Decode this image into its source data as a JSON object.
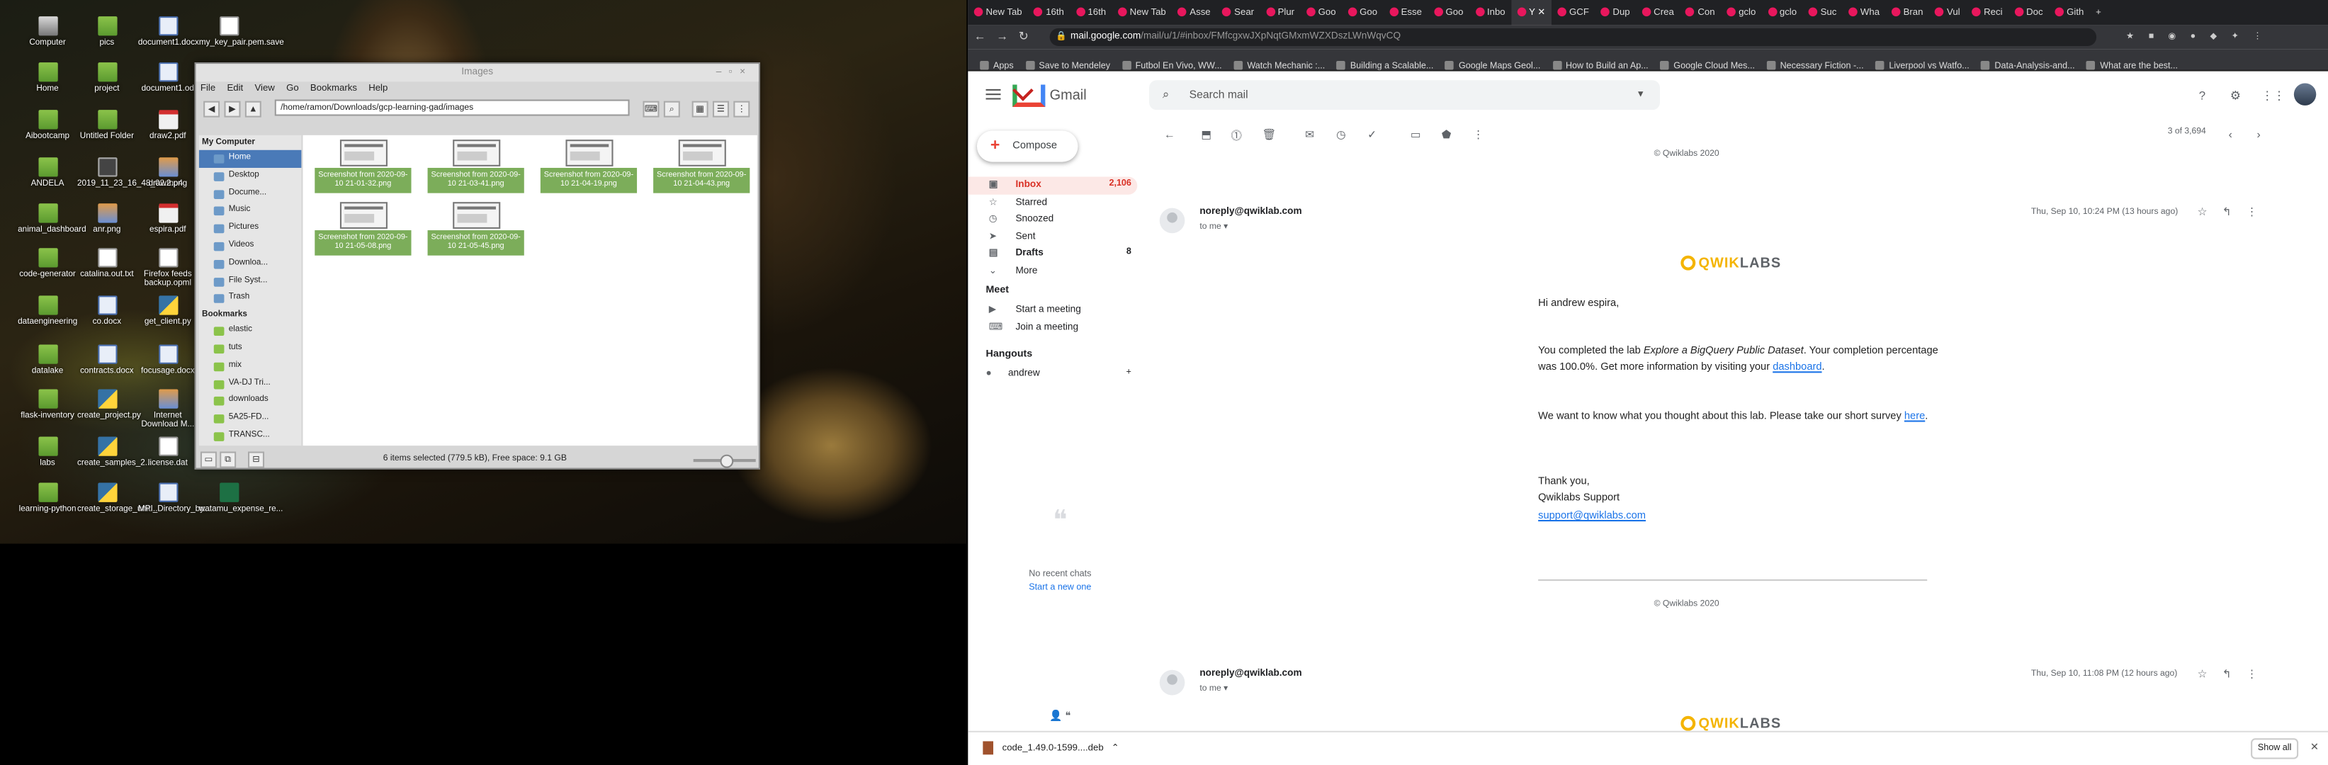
{
  "desktop": {
    "icons": [
      {
        "label": "Computer",
        "glyph": "g-comp"
      },
      {
        "label": "pics",
        "glyph": "g-folder"
      },
      {
        "label": "document1.docx",
        "glyph": "g-doc"
      },
      {
        "label": "my_key_pair.pem.save",
        "glyph": "g-txt"
      },
      {
        "label": "Home",
        "glyph": "g-folder"
      },
      {
        "label": "project",
        "glyph": "g-folder"
      },
      {
        "label": "document1.od",
        "glyph": "g-doc"
      },
      {
        "label": "Aibootcamp",
        "glyph": "g-folder"
      },
      {
        "label": "Untitled Folder",
        "glyph": "g-folder"
      },
      {
        "label": "draw2.pdf",
        "glyph": "g-pdf"
      },
      {
        "label": "ANDELA",
        "glyph": "g-folder"
      },
      {
        "label": "2019_11_23_16_48_02.mp4",
        "glyph": "g-mp4"
      },
      {
        "label": "draw2.png",
        "glyph": "g-img"
      },
      {
        "label": "animal_dashboard",
        "glyph": "g-folder"
      },
      {
        "label": "anr.png",
        "glyph": "g-img"
      },
      {
        "label": "espira.pdf",
        "glyph": "g-pdf"
      },
      {
        "label": "code-generator",
        "glyph": "g-folder"
      },
      {
        "label": "catalina.out.txt",
        "glyph": "g-txt"
      },
      {
        "label": "Firefox feeds backup.opml",
        "glyph": "g-txt"
      },
      {
        "label": "dataengineering",
        "glyph": "g-folder"
      },
      {
        "label": "co.docx",
        "glyph": "g-doc"
      },
      {
        "label": "get_client.py",
        "glyph": "g-py"
      },
      {
        "label": "datalake",
        "glyph": "g-folder"
      },
      {
        "label": "contracts.docx",
        "glyph": "g-doc"
      },
      {
        "label": "focusage.docx",
        "glyph": "g-doc"
      },
      {
        "label": "flask-inventory",
        "glyph": "g-folder"
      },
      {
        "label": "create_project.py",
        "glyph": "g-py"
      },
      {
        "label": "Internet Download M...",
        "glyph": "g-img"
      },
      {
        "label": "labs",
        "glyph": "g-folder"
      },
      {
        "label": "create_samples_2...",
        "glyph": "g-py"
      },
      {
        "label": "license.dat",
        "glyph": "g-txt"
      },
      {
        "label": "learning-python",
        "glyph": "g-folder"
      },
      {
        "label": "create_storage_unit...",
        "glyph": "g-py"
      },
      {
        "label": "MPI_Directory_by...",
        "glyph": "g-doc"
      },
      {
        "label": "watamu_expense_re...",
        "glyph": "g-xls"
      }
    ]
  },
  "filemanager": {
    "title": "Images",
    "menu": [
      "File",
      "Edit",
      "View",
      "Go",
      "Bookmarks",
      "Help"
    ],
    "path": "/home/ramon/Downloads/gcp-learning-gad/images",
    "places_header": "My Computer",
    "places": [
      "Home",
      "Desktop",
      "Docume...",
      "Music",
      "Pictures",
      "Videos",
      "Downloa...",
      "File Syst...",
      "Trash"
    ],
    "bookmarks_header": "Bookmarks",
    "bookmarks": [
      "elastic",
      "tuts",
      "mix",
      "VA-DJ Tri...",
      "downloads",
      "5A25-FD...",
      "TRANSC..."
    ],
    "files": [
      "Screenshot from 2020-09-10 21-01-32.png",
      "Screenshot from 2020-09-10 21-03-41.png",
      "Screenshot from 2020-09-10 21-04-19.png",
      "Screenshot from 2020-09-10 21-04-43.png",
      "Screenshot from 2020-09-10 21-05-08.png",
      "Screenshot from 2020-09-10 21-05-45.png"
    ],
    "status": "6 items selected (779.5 kB), Free space: 9.1 GB"
  },
  "browser": {
    "tabs": [
      "New Tab",
      "16th",
      "16th",
      "New Tab",
      "Asse",
      "Sear",
      "Plur",
      "Goo",
      "Goo",
      "Esse",
      "Goo",
      "Inbo",
      "Y",
      "GCF",
      "Dup",
      "Crea",
      "Con",
      "gclo",
      "gclo",
      "Suc",
      "Wha",
      "Bran",
      "Vul",
      "Reci",
      "Doc",
      "Gith"
    ],
    "active_tab": "Y",
    "url_host": "mail.google.com",
    "url_rest": "/mail/u/1/#inbox/FMfcgxwJXpNqtGMxmWZXDszLWnWqvCQ",
    "bookmarks": [
      "Apps",
      "Save to Mendeley",
      "Futbol En Vivo, WW...",
      "Watch Mechanic :...",
      "Building a Scalable...",
      "Google Maps Geol...",
      "How to Build an Ap...",
      "Google Cloud Mes...",
      "Necessary Fiction -...",
      "Liverpool vs Watfo...",
      "Data-Analysis-and...",
      "What are the best..."
    ]
  },
  "gmail": {
    "product": "Gmail",
    "search_placeholder": "Search mail",
    "compose": "Compose",
    "nav": [
      {
        "label": "Inbox",
        "count": "2,106",
        "icon": "inbox-icon"
      },
      {
        "label": "Starred",
        "count": "",
        "icon": "star-icon"
      },
      {
        "label": "Snoozed",
        "count": "",
        "icon": "clock-icon"
      },
      {
        "label": "Sent",
        "count": "",
        "icon": "send-icon"
      },
      {
        "label": "Drafts",
        "count": "8",
        "icon": "draft-icon"
      },
      {
        "label": "More",
        "count": "",
        "icon": "chevron-down-icon"
      }
    ],
    "meet_header": "Meet",
    "meet_items": [
      "Start a meeting",
      "Join a meeting"
    ],
    "hangouts_header": "Hangouts",
    "hangouts_user": "andrew",
    "no_chats": "No recent chats",
    "start_new": "Start a new one",
    "pager": "3 of 3,694",
    "copyright": "© Qwiklabs 2020",
    "logo_q": "QWIK",
    "logo_l": "LABS",
    "msg1": {
      "sender": "noreply@qwiklab.com",
      "to": "to me",
      "date": "Thu, Sep 10, 10:24 PM (13 hours ago)",
      "greeting": "Hi andrew espira,",
      "p1_a": "You completed the lab ",
      "p1_lab": "Explore a BigQuery Public Dataset",
      "p1_b": ". Your completion percentage was 100.0%. Get more information by visiting your ",
      "p1_link": "dashboard",
      "p1_end": ".",
      "p2_a": "We want to know what you thought about this lab. Please take our short survey ",
      "p2_link": "here",
      "p2_end": ".",
      "thanks": "Thank you,",
      "team": "Qwiklabs Support",
      "email": "support@qwiklabs.com"
    },
    "msg2": {
      "sender": "noreply@qwiklab.com",
      "to": "to me",
      "date": "Thu, Sep 10, 11:08 PM (12 hours ago)"
    }
  },
  "download": {
    "file": "code_1.49.0-1599....deb",
    "show_all": "Show all"
  }
}
